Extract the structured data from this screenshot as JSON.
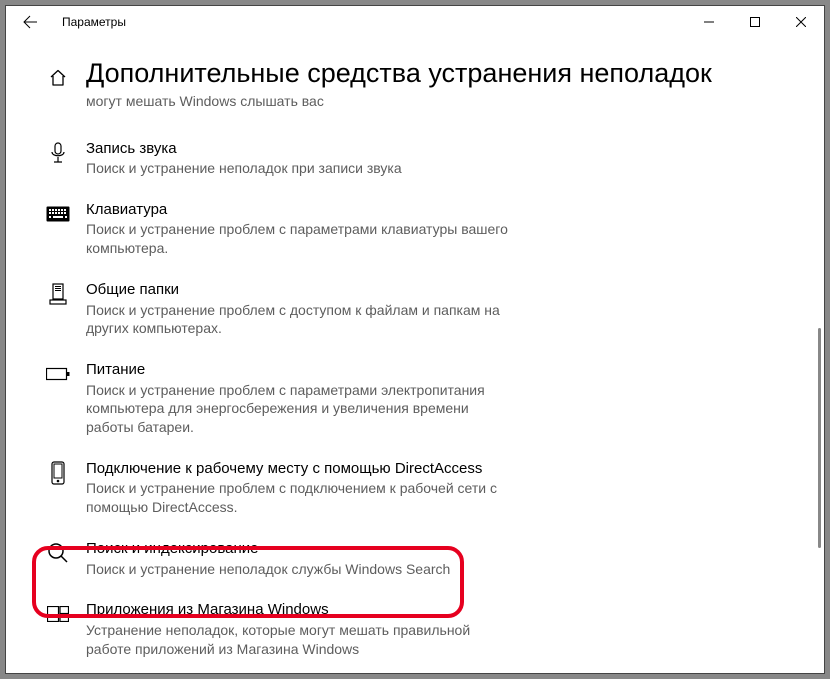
{
  "titlebar": {
    "title": "Параметры"
  },
  "page": {
    "heading": "Дополнительные средства устранения неполадок",
    "subtext": "могут мешать Windows слышать вас"
  },
  "items": [
    {
      "title": "Запись звука",
      "desc": "Поиск и устранение неполадок при записи звука"
    },
    {
      "title": "Клавиатура",
      "desc": "Поиск и устранение проблем с параметрами клавиатуры вашего компьютера."
    },
    {
      "title": "Общие папки",
      "desc": "Поиск и устранение проблем с доступом к файлам и папкам на других компьютерах."
    },
    {
      "title": "Питание",
      "desc": "Поиск и устранение проблем с параметрами электропитания компьютера для энергосбережения и увеличения  времени работы батареи."
    },
    {
      "title": "Подключение к рабочему месту с помощью DirectAccess",
      "desc": "Поиск и устранение проблем с подключением к рабочей сети с помощью DirectAccess."
    },
    {
      "title": "Поиск и индексирование",
      "desc": "Поиск и устранение неполадок службы Windows Search"
    },
    {
      "title": "Приложения из Магазина Windows",
      "desc": "Устранение неполадок, которые  могут мешать правильной работе приложений из Магазина Windows"
    }
  ]
}
